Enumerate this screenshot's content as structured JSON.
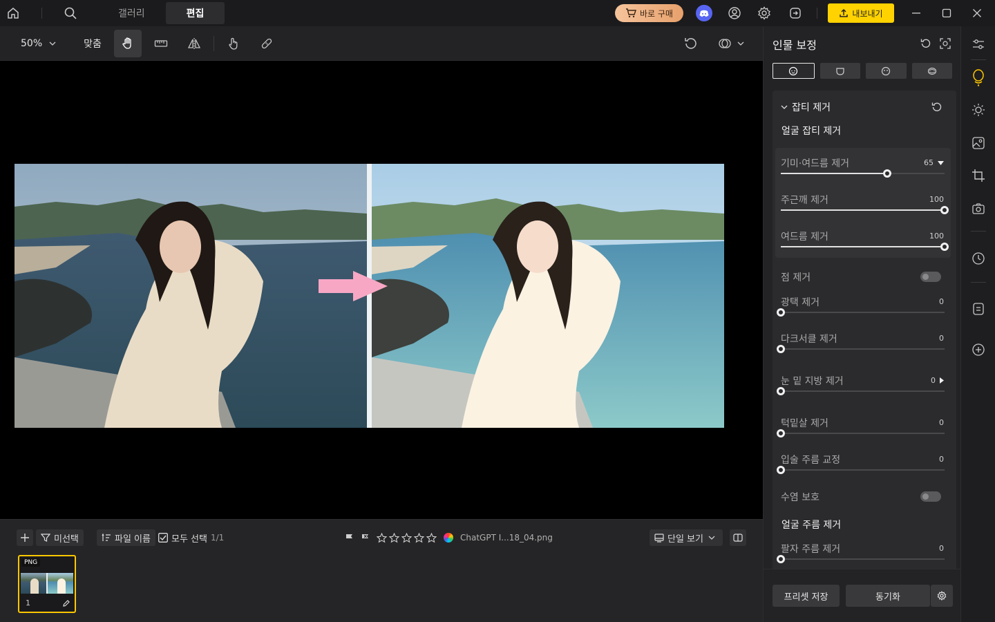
{
  "topbar": {
    "tabs": [
      {
        "label": "갤러리",
        "active": false
      },
      {
        "label": "편집",
        "active": true
      }
    ],
    "buy_label": "바로 구매",
    "export_label": "내보내기"
  },
  "toolbar": {
    "zoom_label": "50%",
    "fit_label": "맞춤"
  },
  "bottombar": {
    "filter_label": "미선택",
    "sort_label": "파일 이름",
    "select_all_label": "모두 선택",
    "select_count": "1/1",
    "filename": "ChatGPT I...18_04.png",
    "view_label": "단일 보기",
    "thumb_format": "PNG",
    "thumb_index": "1",
    "rating_stars": 0
  },
  "panel": {
    "title": "인물 보정",
    "section_title": "잡티 제거",
    "sub1": "얼굴 잡티 제거",
    "sliders_top": [
      {
        "label": "기미·여드름 제거",
        "value": "65",
        "pct": 65,
        "dropdown": true
      },
      {
        "label": "주근깨 제거",
        "value": "100",
        "pct": 100
      },
      {
        "label": "여드름 제거",
        "value": "100",
        "pct": 100
      }
    ],
    "toggle1": "점 제거",
    "sliders_mid": [
      {
        "label": "광택 제거",
        "value": "0",
        "pct": 0
      },
      {
        "label": "다크서클 제거",
        "value": "0",
        "pct": 0
      },
      {
        "label": "눈 밑 지방 제거",
        "value": "0",
        "pct": 0,
        "expand": true
      },
      {
        "label": "턱밑살 제거",
        "value": "0",
        "pct": 0
      },
      {
        "label": "입술 주름 교정",
        "value": "0",
        "pct": 0
      }
    ],
    "toggle2": "수염 보호",
    "sub2": "얼굴 주름 제거",
    "sliders_bottom": [
      {
        "label": "팔자 주름 제거",
        "value": "0",
        "pct": 0
      }
    ],
    "preset_label": "프리셋 저장",
    "sync_label": "동기화"
  },
  "colors": {
    "accent_yellow": "#ffd200",
    "buy_gradient": "#e7a16c",
    "discord": "#5865f2",
    "arrow_pink": "#f7a7c4"
  }
}
